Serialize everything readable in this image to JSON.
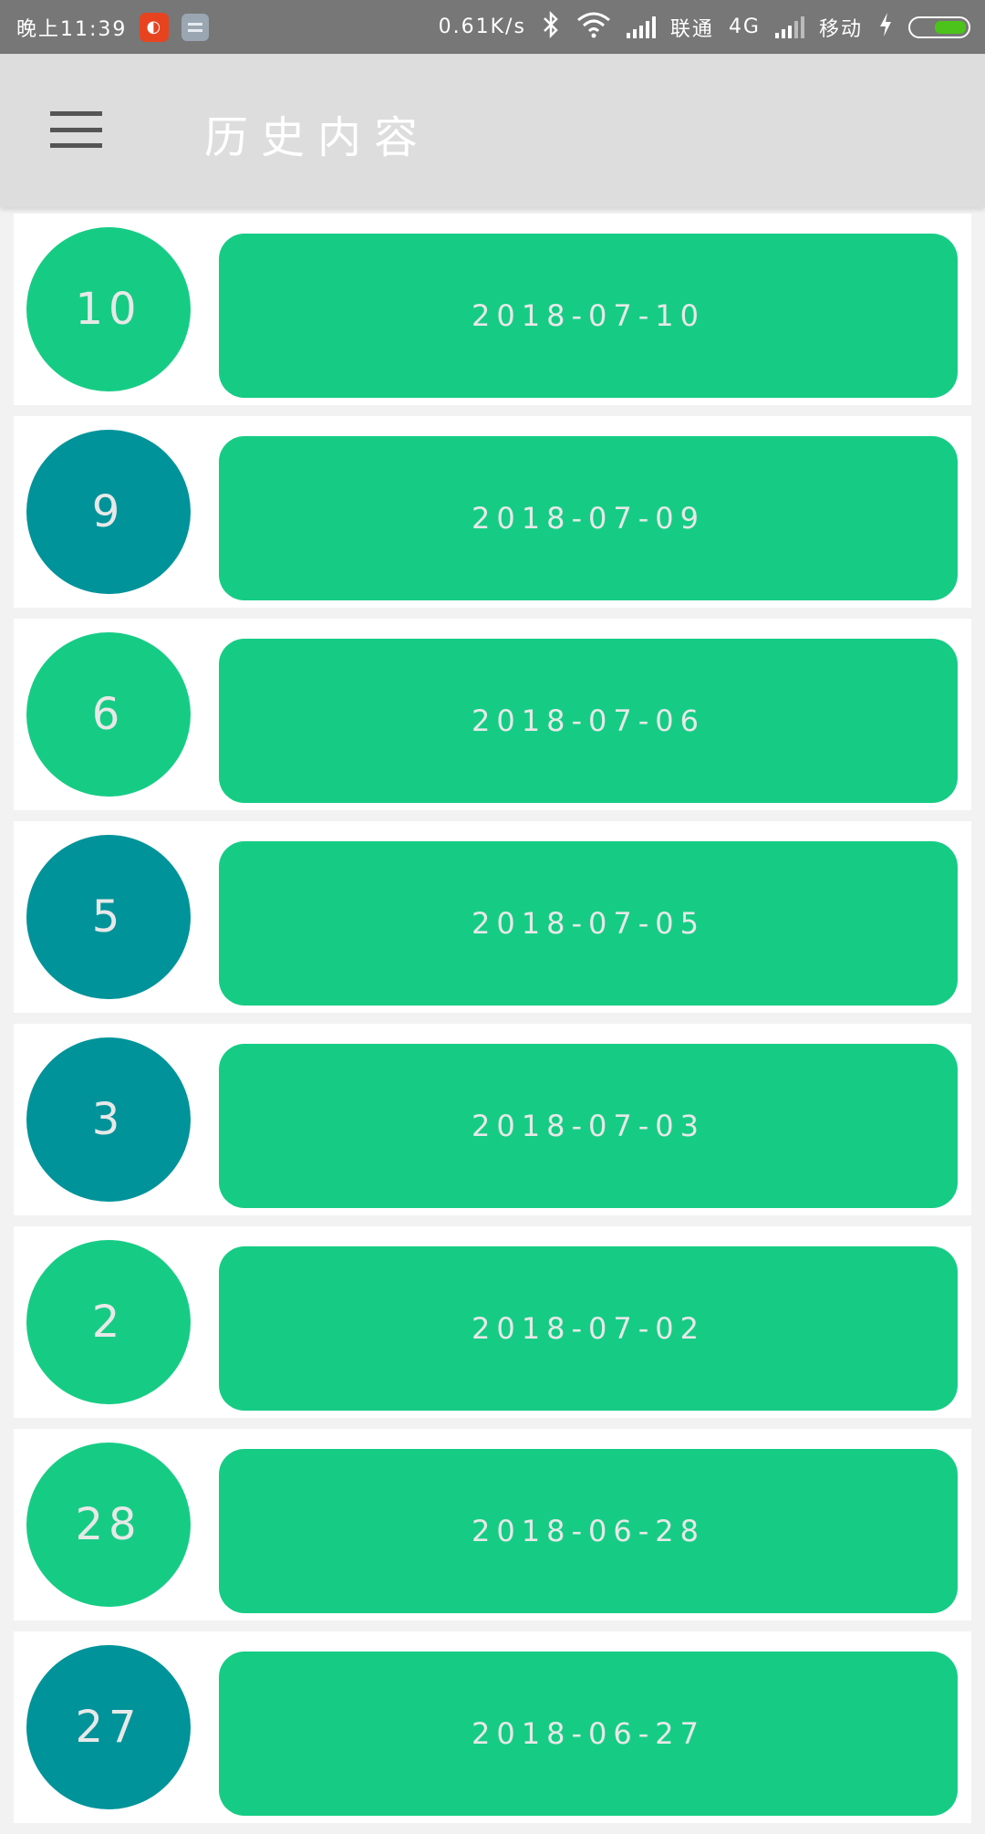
{
  "status_bar": {
    "time": "晚上11:39",
    "net_speed": "0.61K/s",
    "carrier1": "联通",
    "network_type": "4G",
    "carrier2": "移动",
    "icons": [
      "app-notification-icon",
      "app-notification-icon-2",
      "bluetooth-icon",
      "wifi-icon",
      "signal-icon",
      "signal-icon-2",
      "charging-icon",
      "battery-icon"
    ]
  },
  "appbar": {
    "title": "历史内容",
    "menu_icon": "hamburger-menu-icon"
  },
  "colors": {
    "green": "#16cc85",
    "teal": "#00939a",
    "appbar": "#dddddd",
    "statusbar": "#777777"
  },
  "items": [
    {
      "day": "10",
      "date": "2018-07-10",
      "color": "green"
    },
    {
      "day": "9",
      "date": "2018-07-09",
      "color": "teal"
    },
    {
      "day": "6",
      "date": "2018-07-06",
      "color": "green"
    },
    {
      "day": "5",
      "date": "2018-07-05",
      "color": "teal"
    },
    {
      "day": "3",
      "date": "2018-07-03",
      "color": "teal"
    },
    {
      "day": "2",
      "date": "2018-07-02",
      "color": "green"
    },
    {
      "day": "28",
      "date": "2018-06-28",
      "color": "green"
    },
    {
      "day": "27",
      "date": "2018-06-27",
      "color": "teal"
    }
  ]
}
